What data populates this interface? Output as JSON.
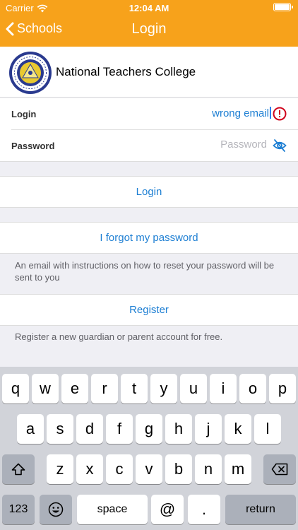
{
  "status_bar": {
    "carrier": "Carrier",
    "time": "12:04 AM"
  },
  "nav": {
    "back_label": "Schools",
    "title": "Login"
  },
  "school": {
    "name": "National Teachers College"
  },
  "login_field": {
    "label": "Login",
    "value": "wrong email"
  },
  "password_field": {
    "label": "Password",
    "placeholder": "Password"
  },
  "login_button": {
    "label": "Login"
  },
  "forgot": {
    "label": "I forgot my password",
    "note": "An email with instructions on how to reset your password will be sent to you"
  },
  "register": {
    "label": "Register",
    "note": "Register a new guardian or parent account for free."
  },
  "keyboard": {
    "row1": [
      "q",
      "w",
      "e",
      "r",
      "t",
      "y",
      "u",
      "i",
      "o",
      "p"
    ],
    "row2": [
      "a",
      "s",
      "d",
      "f",
      "g",
      "h",
      "j",
      "k",
      "l"
    ],
    "row3": [
      "z",
      "x",
      "c",
      "v",
      "b",
      "n",
      "m"
    ],
    "numbers_label": "123",
    "space_label": "space",
    "at_label": "@",
    "dot_label": ".",
    "return_label": "return"
  },
  "colors": {
    "accent": "#f7a21b",
    "link": "#1e7fd3",
    "error": "#d0021b"
  },
  "icons": {
    "error": "error-circle-icon",
    "visibility": "eye-slash-icon"
  }
}
